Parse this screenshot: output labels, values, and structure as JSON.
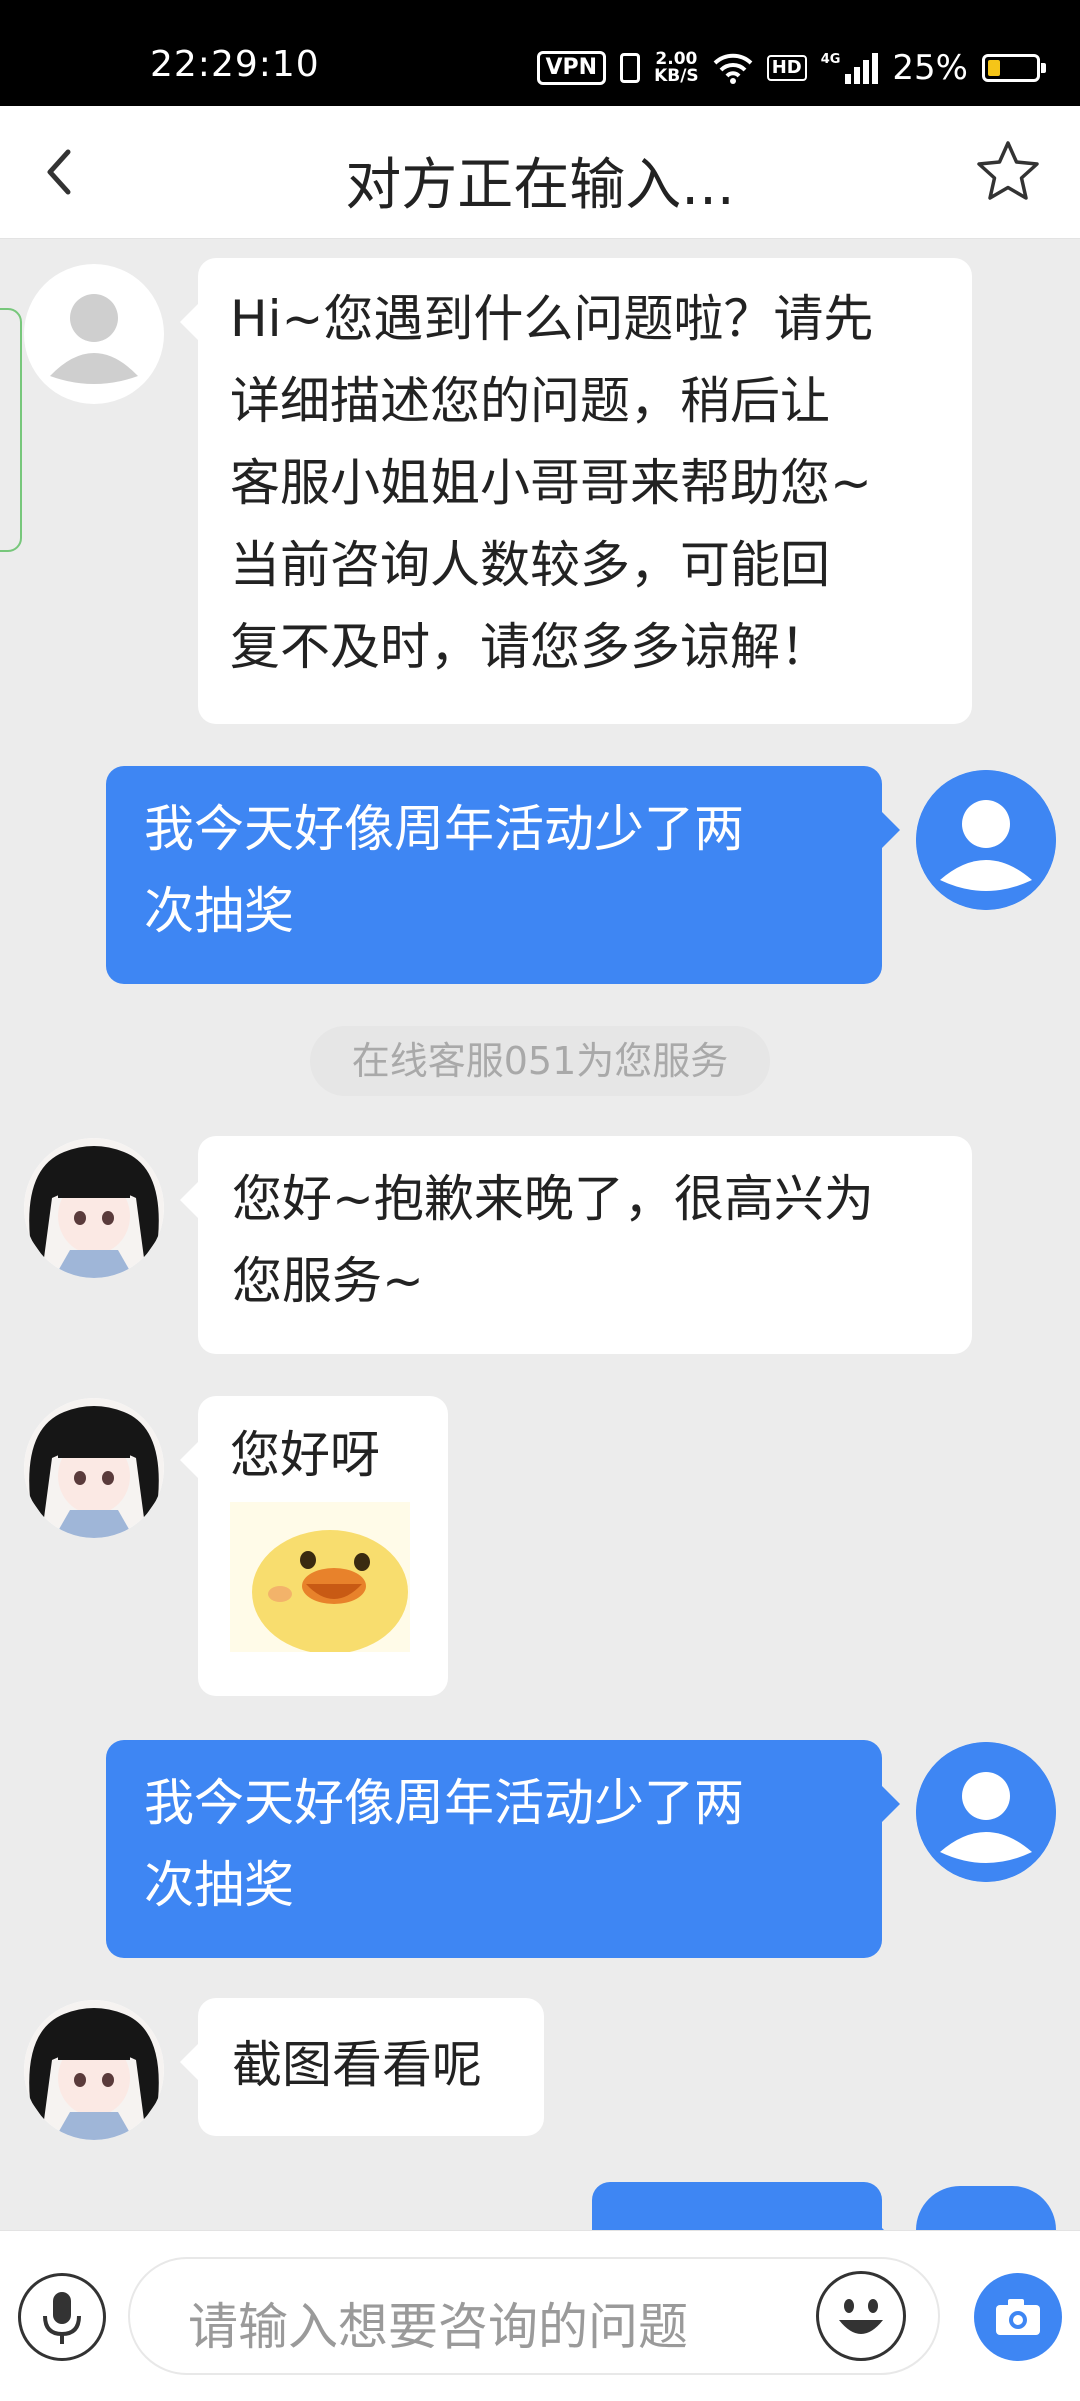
{
  "status_bar": {
    "time": "22:29:10",
    "vpn": "VPN",
    "net_speed_value": "2.00",
    "net_speed_unit": "KB/S",
    "hd": "HD",
    "network": "4G",
    "battery_pct": "25%"
  },
  "header": {
    "title": "对方正在输入..."
  },
  "messages": [
    {
      "side": "left",
      "avatar": "default-avatar",
      "text": "Hi~您遇到什么问题啦？请先\n详细描述您的问题，稍后让\n客服小姐姐小哥哥来帮助您~\n当前咨询人数较多，可能回\n复不及时，请您多多谅解！"
    },
    {
      "side": "right",
      "avatar": "user-avatar",
      "text": "我今天好像周年活动少了两\n次抽奖"
    },
    {
      "side": "left",
      "avatar": "agent-avatar",
      "text": "您好~抱歉来晚了，很高兴为\n您服务~"
    },
    {
      "side": "left",
      "avatar": "agent-avatar",
      "text": "您好呀",
      "sticker": "smiling-chick"
    },
    {
      "side": "right",
      "avatar": "user-avatar",
      "text": "我今天好像周年活动少了两\n次抽奖"
    },
    {
      "side": "left",
      "avatar": "agent-avatar",
      "text": "截图看看呢"
    }
  ],
  "system_note": "在线客服051为您服务",
  "input_bar": {
    "placeholder": "请输入想要咨询的问题"
  },
  "colors": {
    "accent": "#3e86f3",
    "background": "#ececec",
    "bubble_left": "#ffffff"
  }
}
